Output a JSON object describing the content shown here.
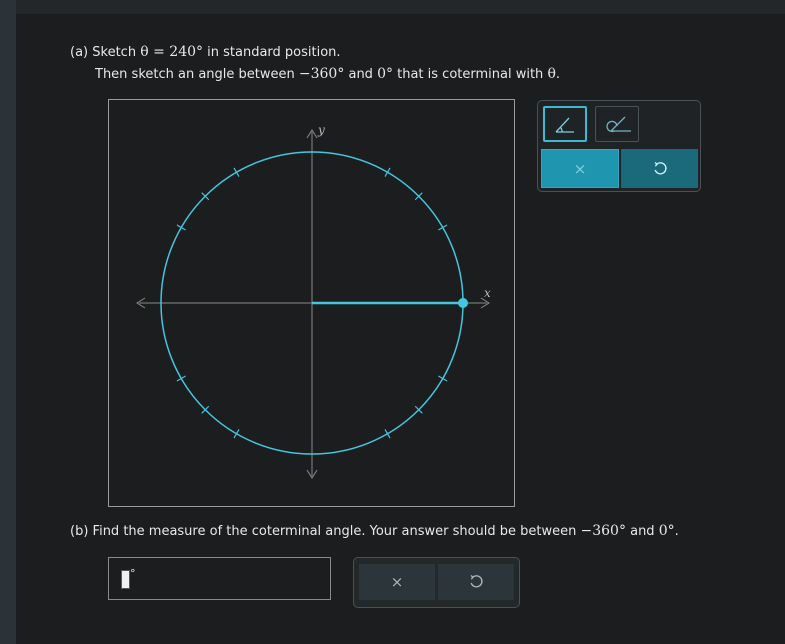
{
  "part_a": {
    "label": "(a)",
    "line1_pre": "Sketch ",
    "theta": "θ",
    "equals": " = ",
    "angle": "240°",
    "line1_post": " in standard position.",
    "line2_pre": "Then sketch an angle between ",
    "lower": "−360°",
    "and": " and ",
    "upper": "0°",
    "line2_post": " that is coterminal with ",
    "theta2": "θ",
    "period": "."
  },
  "graph": {
    "x_axis_label": "x",
    "y_axis_label": "y",
    "circle_color": "#45c5e0",
    "ray_color": "#45c5e0"
  },
  "tools": {
    "angle_tool": "angle-tool-icon",
    "arc_angle_tool": "arc-angle-tool-icon",
    "clear_label": "×",
    "undo_icon": "undo-icon"
  },
  "part_b": {
    "label": "(b)",
    "text_pre": "Find the measure of the coterminal angle. Your answer should be between ",
    "lower": "−360°",
    "and": " and ",
    "upper": "0°",
    "period": "."
  },
  "answer": {
    "value": "",
    "unit": "°",
    "clear_label": "×",
    "undo_icon": "undo-icon"
  }
}
